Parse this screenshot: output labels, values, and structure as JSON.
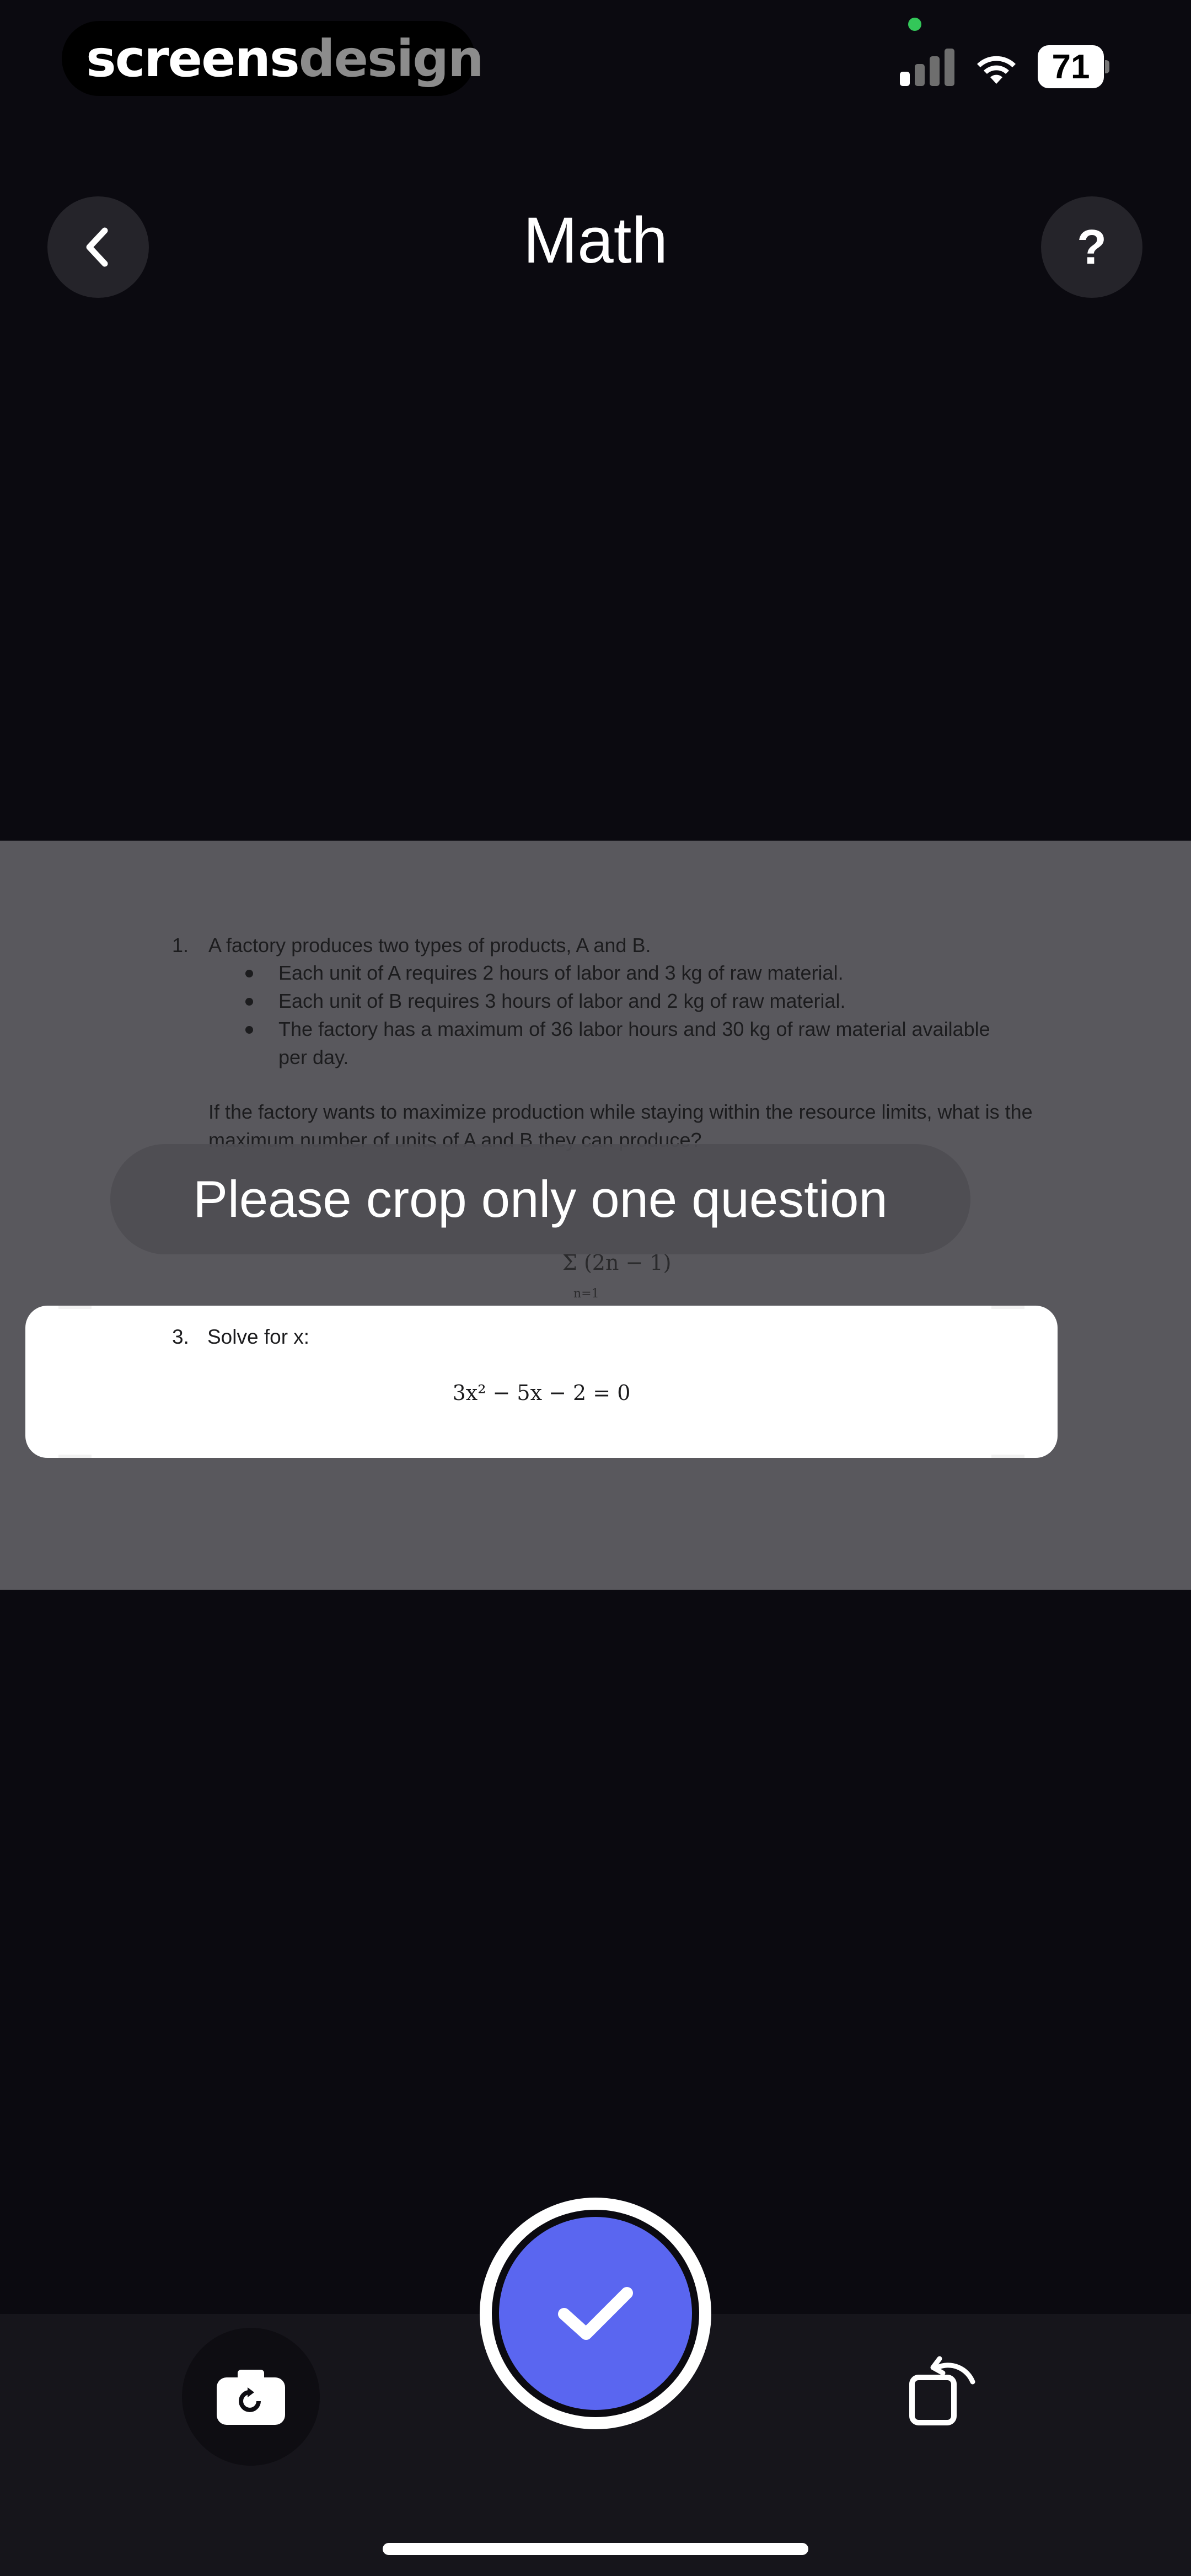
{
  "status_bar": {
    "brand_part1": "screens",
    "brand_part2": "design",
    "battery_level": "71",
    "icons": [
      "signal-icon",
      "wifi-icon",
      "battery-icon"
    ]
  },
  "header": {
    "title": "Math",
    "back_icon": "chevron-left-icon",
    "help_label": "?"
  },
  "document": {
    "q1_number": "1.",
    "q1_intro": "A factory produces two types of products, A and B.",
    "q1_bullets": [
      "Each unit of A requires 2 hours of labor and 3 kg of raw material.",
      "Each unit of B requires 3 hours of labor and 2 kg of raw material.",
      "The factory has a maximum of 36 labor hours and 30 kg of raw material available per day."
    ],
    "q1_question": "If the factory wants to maximize production while staying within the resource limits, what is the maximum number of units of A and B they can produce?",
    "sum_expression": "Σ (2n − 1)",
    "sum_lower": "n=1"
  },
  "crop": {
    "q3_number": "3.",
    "q3_text": "Solve for x:",
    "equation": "3x² − 5x − 2 = 0"
  },
  "toast": {
    "message": "Please crop only one question"
  },
  "bottom_bar": {
    "retake_icon": "camera-rotate-icon",
    "confirm_icon": "checkmark-icon",
    "rotate_icon": "rotate-image-icon"
  },
  "colors": {
    "background": "#0b0a10",
    "accent": "#5a66f0",
    "document_bg": "#59585d"
  }
}
